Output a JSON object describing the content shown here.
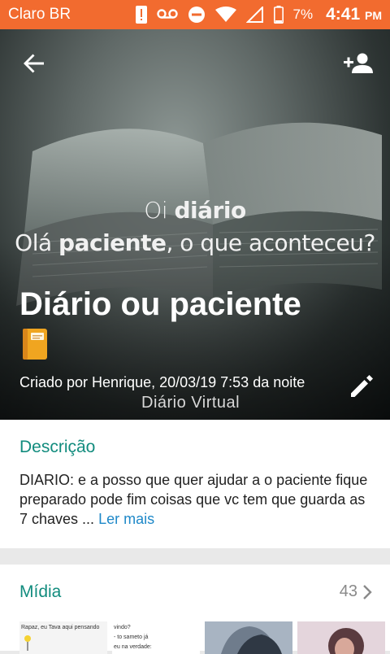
{
  "status_bar": {
    "carrier": "Claro BR",
    "battery_percent": "7%",
    "time": "4:41",
    "ampm": "PM",
    "icons": [
      "alert-icon",
      "voicemail-icon",
      "dnd-icon",
      "wifi-icon",
      "no-signal-icon",
      "battery-icon"
    ]
  },
  "toolbar": {
    "back_icon": "arrow-back-icon",
    "add_participant_icon": "add-person-icon"
  },
  "hero": {
    "overlay_line1_plain": "Oi ",
    "overlay_line1_bold": "diário",
    "overlay_line2_plain_a": "Olá ",
    "overlay_line2_bold": "paciente",
    "overlay_line2_plain_b": ", o que aconteceu?",
    "watermark": "Diário Virtual",
    "group_name": "Diário ou paciente",
    "group_emoji": "notebook-emoji",
    "created_by": "Criado por Henrique, 20/03/19 7:53 da noite",
    "edit_icon": "pencil-icon"
  },
  "description": {
    "title": "Descrição",
    "text": "DIARIO: e a posso que quer ajudar a o paciente fique preparado pode fim coisas que vc tem que guarda as 7 chaves ... ",
    "read_more": "Ler mais"
  },
  "media": {
    "title": "Mídia",
    "count": "43",
    "thumbnails": [
      {
        "text_a": "Rapaz, eu Tava aqui pensando"
      },
      {
        "text_a": "vindo?",
        "text_b": "- to sameto já",
        "text_c": "eu na verdade:"
      },
      {
        "image": "sketch"
      },
      {
        "image": "photo"
      }
    ]
  },
  "colors": {
    "status_bar": "#f26b2f",
    "accent_green": "#128c7e",
    "link_blue": "#1e88c8"
  }
}
